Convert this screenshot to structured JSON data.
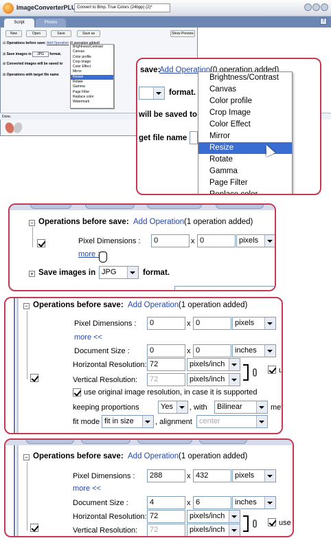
{
  "app": {
    "title": "ImageConverterPLUS",
    "convert_select": "Convert to Bmp. True Colors (24bpp) (2)*",
    "tabs": [
      "Script",
      "Photos"
    ],
    "help_icon": "help-icon",
    "toolbar": [
      "New",
      "Open",
      "Save",
      "Save as"
    ],
    "show_preview": "Show Preview",
    "status": "Done."
  },
  "mini": {
    "ops_label": "Operations before save:",
    "ops_link": "Add Operation",
    "ops_count": "(0 operation added)",
    "save_in": "Save images in",
    "save_fmt": "JPG",
    "save_suffix": "format.",
    "converted": "Converted images will be saved to",
    "target": "Operations with target file name"
  },
  "callout1": {
    "ops_label": "save:",
    "ops_link": "Add Operation",
    "ops_count": "(0 operation added)",
    "format_label": "format.",
    "saved_to": "will be saved to",
    "target": "get file name",
    "menu_items": [
      "Brightness/Contrast",
      "Canvas",
      "Color profile",
      "Crop Image",
      "Color Effect",
      "Mirror",
      "Resize",
      "Rotate",
      "Gamma",
      "Page Filter",
      "Replace color",
      "Watermark"
    ],
    "highlighted": "Resize"
  },
  "callout2": {
    "ops_label": "Operations before save:",
    "ops_link": "Add Operation",
    "ops_count": "(1 operation added)",
    "pixel_dim": "Pixel Dimensions :",
    "w": "0",
    "x": "x",
    "h": "0",
    "unit": "pixels",
    "more": "more >>",
    "save_in": "Save images in",
    "fmt": "JPG",
    "fmt_suffix": "format."
  },
  "callout3": {
    "ops_label": "Operations before save:",
    "ops_link": "Add Operation",
    "ops_count": "(1 operation added)",
    "pixel_dim": "Pixel Dimensions :",
    "pw": "0",
    "ph": "0",
    "punit": "pixels",
    "more": "more <<",
    "doc_size": "Document Size :",
    "dw": "0",
    "dh": "0",
    "dunit": "inches",
    "hres_label": "Horizontal Resolution:",
    "hres": "72",
    "res_unit": "pixels/inch",
    "vres_label": "Vertical Resolution:",
    "vres": "72",
    "use": "us",
    "use_original": "use original image resolution, in case it is supported",
    "keep_prop": "keeping proportions",
    "keep_val": "Yes",
    "with": ", with",
    "method_val": "Bilinear",
    "method": "meth",
    "fit_mode": "fit mode",
    "fit_val": "fit in size",
    "alignment": ", alignment",
    "align_val": "center"
  },
  "callout4": {
    "ops_label": "Operations before save:",
    "ops_link": "Add Operation",
    "ops_count": "(1 operation added)",
    "pixel_dim": "Pixel Dimensions :",
    "pw": "288",
    "ph": "432",
    "punit": "pixels",
    "more": "more <<",
    "doc_size": "Document Size :",
    "dw": "4",
    "dh": "6",
    "dunit": "inches",
    "hres_label": "Horizontal Resolution:",
    "hres": "72",
    "res_unit": "pixels/inch",
    "vres_label": "Vertical Resolution:",
    "vres": "72",
    "use": "use"
  }
}
